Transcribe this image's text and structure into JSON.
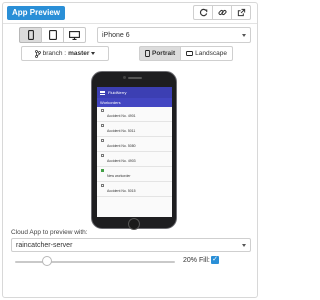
{
  "header": {
    "title": "App Preview",
    "buttons": [
      {
        "icon": "refresh-icon"
      },
      {
        "icon": "link-icon"
      },
      {
        "icon": "external-link-icon"
      }
    ]
  },
  "device_types": [
    {
      "icon": "phone-icon",
      "active": true
    },
    {
      "icon": "tablet-icon",
      "active": false
    },
    {
      "icon": "desktop-icon",
      "active": false
    }
  ],
  "device_select": {
    "value": "iPhone 6"
  },
  "branch": {
    "prefix": "branch :",
    "value": "master"
  },
  "orientation": {
    "portrait": "Portrait",
    "landscape": "Landscape",
    "selected": "Portrait"
  },
  "preview_app": {
    "app_title": "FluidNerry",
    "subtitle": "Workorders",
    "items": [
      {
        "text": "Accident No. 4901",
        "done": false
      },
      {
        "text": "Accident No. 5011",
        "done": false
      },
      {
        "text": "Accident No. 5080",
        "done": false
      },
      {
        "text": "Accident No. 4903",
        "done": false
      },
      {
        "text": "New workorder",
        "done": true
      },
      {
        "text": "Accident No. 5015",
        "done": false
      }
    ]
  },
  "cloud_app": {
    "label": "Cloud App to preview with:",
    "value": "raincatcher-server"
  },
  "zoom": {
    "percent": 20,
    "text": "20%",
    "fill_label": "Fill:",
    "fill_checked": true
  },
  "colors": {
    "accent": "#2a8fd7",
    "app_bar": "#3c3fb3"
  }
}
